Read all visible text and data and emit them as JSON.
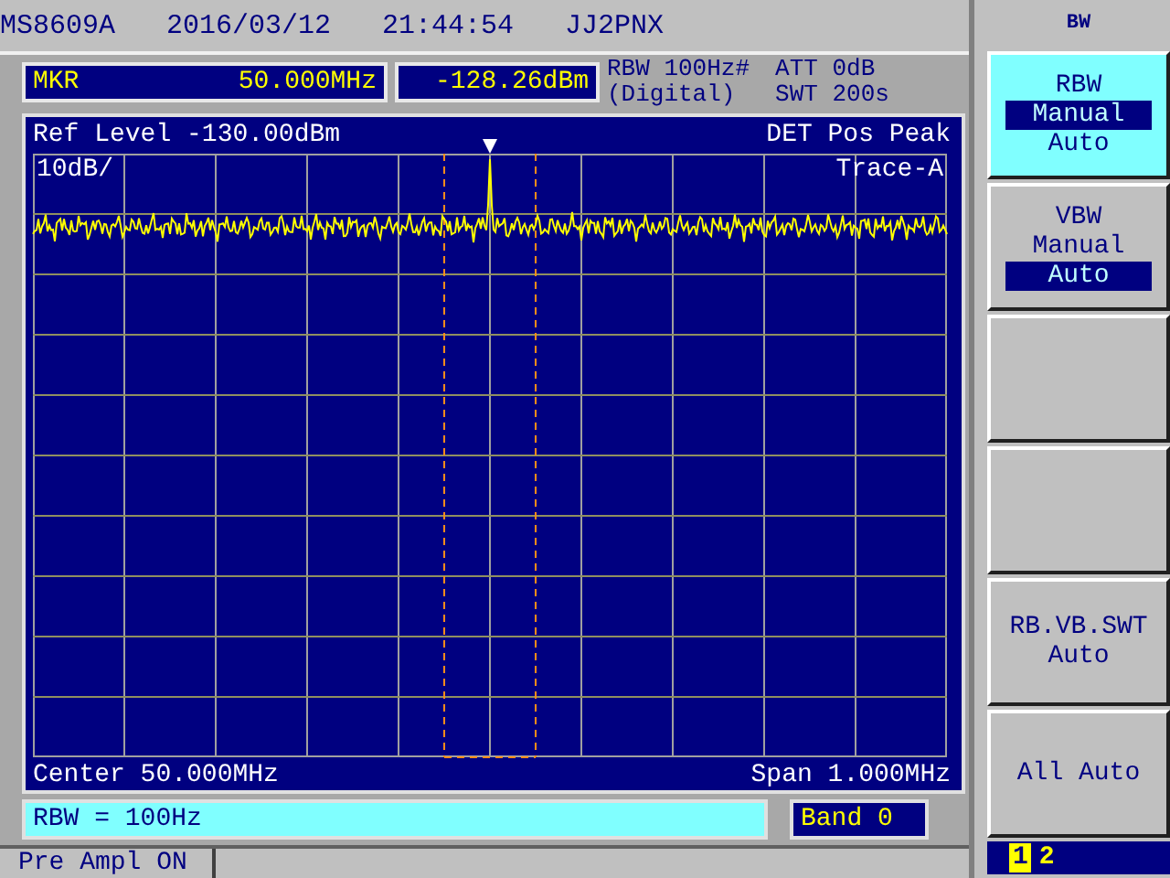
{
  "title_bar": {
    "model": "MS8609A",
    "date": "2016/03/12",
    "time": "21:44:54",
    "callsign": "JJ2PNX"
  },
  "marker": {
    "label": "MKR",
    "frequency": "50.000MHz",
    "level": "-128.26dBm"
  },
  "settings": {
    "rbw": "RBW 100Hz#",
    "rbw_mode": "(Digital)",
    "att": "ATT 0dB",
    "swt": "SWT 200s"
  },
  "plot": {
    "ref_level": "Ref Level -130.00dBm",
    "detector": "DET  Pos Peak",
    "scale": "10dB/",
    "trace": "Trace-A",
    "center": "Center 50.000MHz",
    "span": "Span 1.000MHz"
  },
  "message": "RBW = 100Hz",
  "band": "Band 0",
  "status_bar": {
    "preamp": "Pre Ampl  ON"
  },
  "softkey_menu": {
    "title": "BW",
    "keys": [
      {
        "kind": "toggle",
        "active": true,
        "label": "RBW",
        "options": [
          {
            "label": "Manual",
            "selected": true
          },
          {
            "label": "Auto",
            "selected": false
          }
        ]
      },
      {
        "kind": "toggle",
        "active": false,
        "label": "VBW",
        "options": [
          {
            "label": "Manual",
            "selected": false
          },
          {
            "label": "Auto",
            "selected": true
          }
        ]
      },
      {
        "kind": "blank"
      },
      {
        "kind": "blank"
      },
      {
        "kind": "action",
        "lines": [
          "RB.VB.SWT",
          "Auto"
        ]
      },
      {
        "kind": "action",
        "lines": [
          "All Auto"
        ]
      }
    ],
    "pages": [
      {
        "label": "1",
        "selected": true
      },
      {
        "label": "2",
        "selected": false
      }
    ]
  }
}
